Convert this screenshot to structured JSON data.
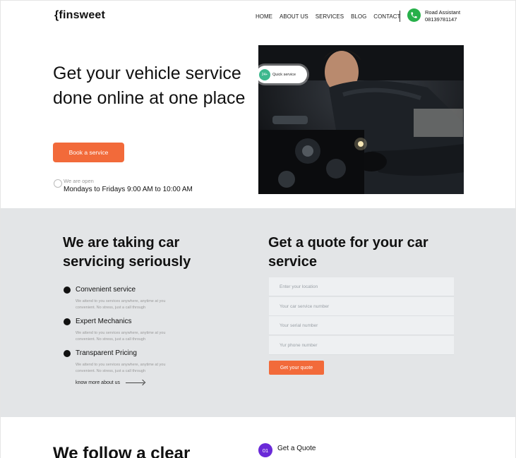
{
  "header": {
    "logo": "{finsweet",
    "nav": [
      "HOME",
      "ABOUT US",
      "SERVICES",
      "BLOG",
      "CONTACT"
    ],
    "assistant_label": "Road Assistant",
    "assistant_phone": "08139781147",
    "icons": {
      "phone": "phone-icon"
    }
  },
  "hero": {
    "title": "Get your vehicle service done online at one place",
    "cta": "Book a service",
    "open_label": "We are open",
    "open_hours": "Mondays to Fridays 9:00 AM to 10:00 AM",
    "badge_short": "24+",
    "badge_text": "Quick service"
  },
  "services": {
    "title": "We are taking car servicing seriously",
    "features": [
      {
        "title": "Convenient service",
        "desc": "We attend to you services anywhere, anytime at you convenient. No stress, just a call through"
      },
      {
        "title": "Expert Mechanics",
        "desc": "We attend to you services anywhere, anytime at you convenient. No stress, just a call through"
      },
      {
        "title": "Transparent Pricing",
        "desc": "We attend to you services anywhere, anytime at you convenient. No stress, just a call through"
      }
    ],
    "link": "know more about us"
  },
  "quote": {
    "title": "Get a quote for your car service",
    "fields": [
      "Enter your location",
      "Your car service number",
      "Your serial number",
      "Yur phone number"
    ],
    "submit": "Get your quote"
  },
  "process": {
    "title": "We follow a clear",
    "step_number": "01",
    "step_label": "Get a Quote"
  },
  "colors": {
    "accent": "#f26a3a",
    "grey_bg": "#e3e5e7",
    "step": "#6a2ad8",
    "phone": "#27b04a"
  }
}
